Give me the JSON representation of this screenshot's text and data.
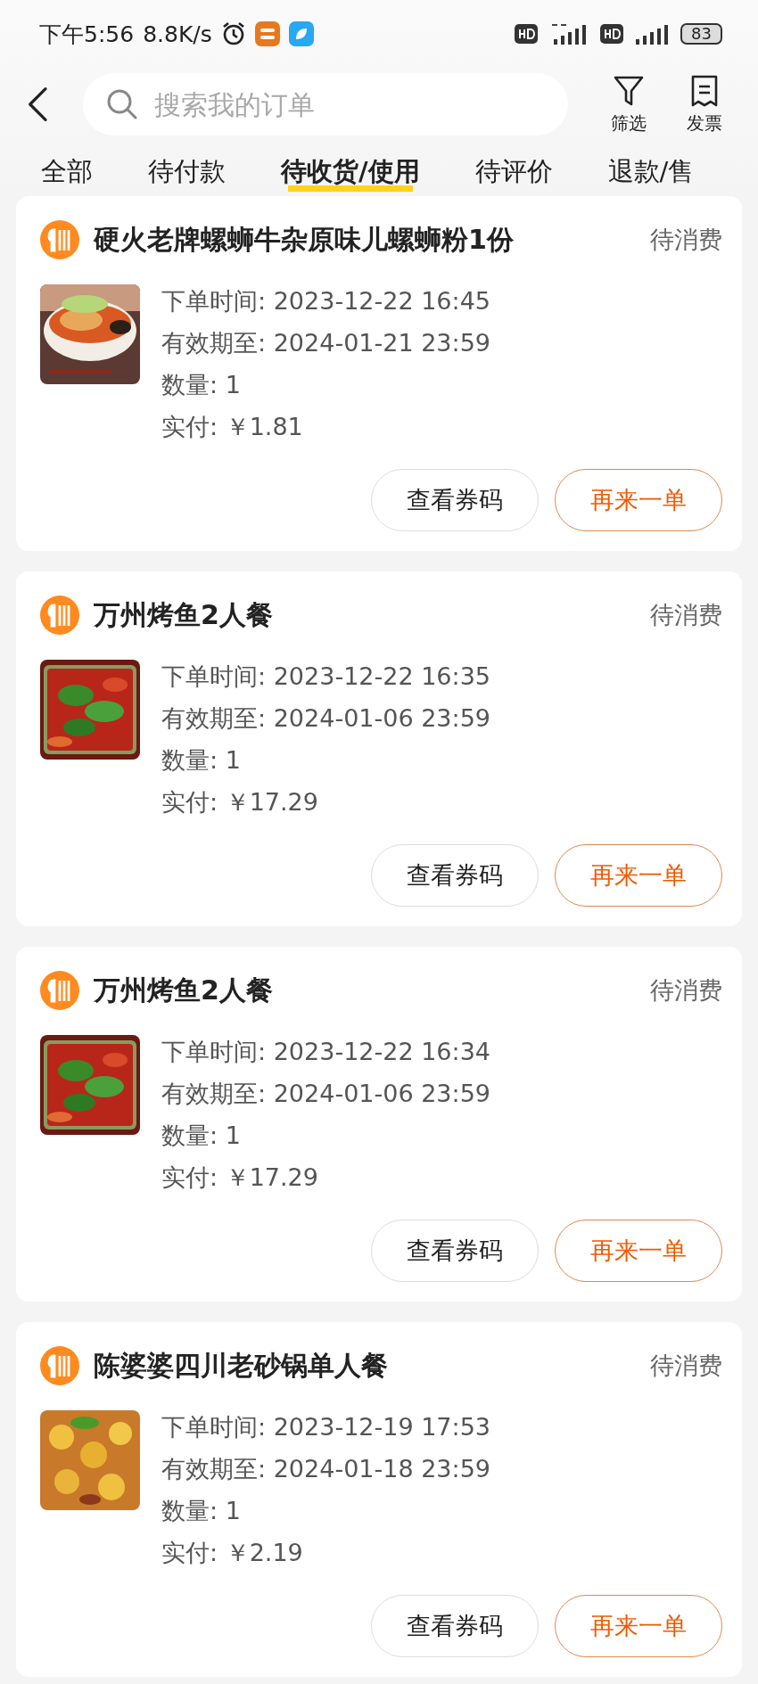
{
  "status_bar": {
    "time": "下午5:56",
    "speed": "8.8K/s",
    "battery": "83"
  },
  "header": {
    "search": {
      "placeholder": "搜索我的订单"
    },
    "actions": [
      {
        "kind": "filter",
        "label": "筛选"
      },
      {
        "kind": "invoice",
        "label": "发票"
      }
    ]
  },
  "tabs": [
    {
      "label": "全部",
      "selected": false
    },
    {
      "label": "待付款",
      "selected": false
    },
    {
      "label": "待收货/使用",
      "selected": true
    },
    {
      "label": "待评价",
      "selected": false
    },
    {
      "label": "退款/售",
      "selected": false
    }
  ],
  "orders": [
    {
      "title": "硬火老牌螺蛳牛杂原味儿螺蛳粉1份",
      "status": "待消费",
      "lines": [
        "下单时间: 2023-12-22 16:45",
        "有效期至: 2024-01-21 23:59",
        "数量: 1",
        "实付: ￥1.81"
      ],
      "buttons": [
        {
          "kind": "secondary",
          "label": "查看券码"
        },
        {
          "kind": "primary",
          "label": "再来一单"
        }
      ]
    },
    {
      "title": "万州烤鱼2人餐",
      "status": "待消费",
      "lines": [
        "下单时间: 2023-12-22 16:35",
        "有效期至: 2024-01-06 23:59",
        "数量: 1",
        "实付: ￥17.29"
      ],
      "buttons": [
        {
          "kind": "secondary",
          "label": "查看券码"
        },
        {
          "kind": "primary",
          "label": "再来一单"
        }
      ]
    },
    {
      "title": "万州烤鱼2人餐",
      "status": "待消费",
      "lines": [
        "下单时间: 2023-12-22 16:34",
        "有效期至: 2024-01-06 23:59",
        "数量: 1",
        "实付: ￥17.29"
      ],
      "buttons": [
        {
          "kind": "secondary",
          "label": "查看券码"
        },
        {
          "kind": "primary",
          "label": "再来一单"
        }
      ]
    },
    {
      "title": "陈婆婆四川老砂锅单人餐",
      "status": "待消费",
      "lines": [
        "下单时间: 2023-12-19 17:53",
        "有效期至: 2024-01-18 23:59",
        "数量: 1",
        "实付: ￥2.19"
      ],
      "buttons": [
        {
          "kind": "secondary",
          "label": "查看券码"
        },
        {
          "kind": "primary",
          "label": "再来一单"
        }
      ]
    }
  ]
}
